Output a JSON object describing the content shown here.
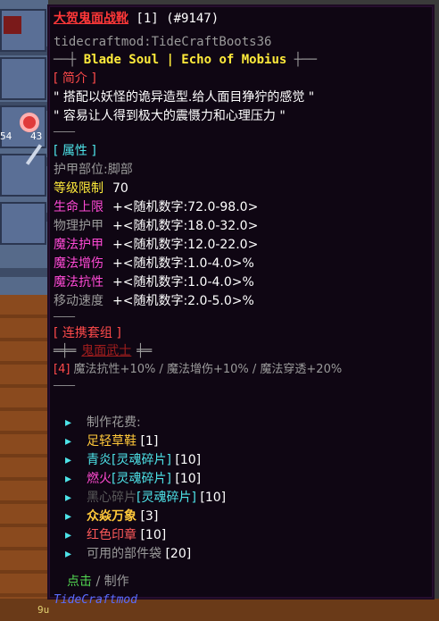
{
  "inventory": {
    "counts": [
      "54",
      "43",
      "9u"
    ]
  },
  "tooltip": {
    "title": "大贺鬼面战靴",
    "title_suffix": " [1] (#9147)",
    "item_id": "tidecraftmod:TideCraftBoots36",
    "series_left": "──┼",
    "series_name": " Blade Soul | Echo of Mobius ",
    "series_right": "┼──",
    "intro_header": "[ 简介 ]",
    "intro_1": "\" 搭配以妖怪的诡异造型.给人面目狰狞的感觉 \"",
    "intro_2": "\" 容易让人得到极大的震慑力和心理压力 \"",
    "sep": "────",
    "attr_header": "[ 属性 ]",
    "slot_label": "护甲部位:",
    "slot_value": "脚部",
    "level_label": "等级限制",
    "level_value": "70",
    "stats": [
      {
        "name": "生命上限",
        "value": "+<随机数字:72.0-98.0>",
        "color": "#ff4ad6"
      },
      {
        "name": "物理护甲",
        "value": "+<随机数字:18.0-32.0>",
        "color": "#9a9a9a"
      },
      {
        "name": "魔法护甲",
        "value": "+<随机数字:12.0-22.0>",
        "color": "#ff4ad6"
      },
      {
        "name": "魔法增伤",
        "value": "+<随机数字:1.0-4.0>%",
        "color": "#ff4ad6"
      },
      {
        "name": "魔法抗性",
        "value": "+<随机数字:1.0-4.0>%",
        "color": "#ff4ad6"
      },
      {
        "name": "移动速度",
        "value": "+<随机数字:2.0-5.0>%",
        "color": "#9a9a9a"
      }
    ],
    "set_header": "[ 连携套组 ]",
    "set_left": "═╪═",
    "set_name": "鬼面武士",
    "set_right": "╪═",
    "set_bonus_tag": "[4]",
    "set_bonus": " 魔法抗性+10% / 魔法增伤+10% / 魔法穿透+20%",
    "craft_header": "制作花费:",
    "craft_items": [
      {
        "name": "足轻草鞋",
        "suffix": " [1]",
        "color": "#ffc83a",
        "parts": null
      },
      {
        "name": "青炎",
        "suffix": " [10]",
        "color": "#4de3e8",
        "parts": "[灵魂碎片]"
      },
      {
        "name": "燃火",
        "suffix": " [10]",
        "color": "#ff4ad0",
        "parts": "[灵魂碎片]"
      },
      {
        "name": "黑心碎片",
        "suffix": " [10]",
        "color": "#5a5a5a",
        "parts": "[灵魂碎片]"
      },
      {
        "name": "众焱万象",
        "suffix": " [3]",
        "color": "#ffc83a",
        "parts": null
      },
      {
        "name": "红色印章",
        "suffix": " [10]",
        "color": "#ff5a5a",
        "parts": null
      },
      {
        "name": "可用的部件袋",
        "suffix": " [20]",
        "color": "#9a9a9a",
        "parts": null
      }
    ],
    "click_label": "点击",
    "click_sep": " / ",
    "craft_action": "制作",
    "mod_name": "TideCraftmod"
  }
}
